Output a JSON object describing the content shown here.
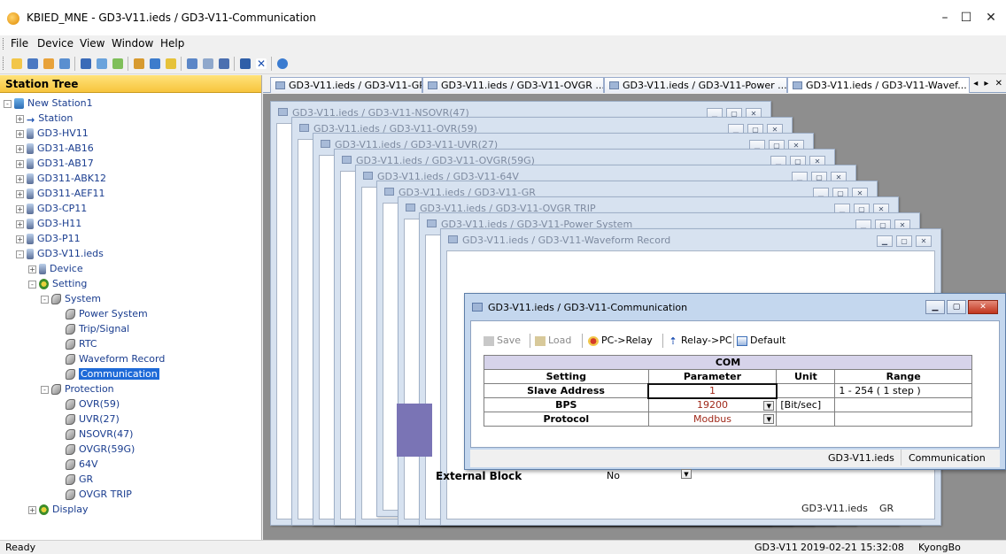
{
  "window": {
    "title": "KBIED_MNE - GD3-V11.ieds / GD3-V11-Communication",
    "controls": [
      "–",
      "☐",
      "✕"
    ]
  },
  "menu": [
    "File",
    "Device",
    "View",
    "Window",
    "Help"
  ],
  "toolbar_icons": [
    "new-icon",
    "save-icon",
    "open-icon",
    "network-icon",
    "list-icon",
    "device-icon",
    "refresh-icon",
    "edit-icon",
    "monitor-icon",
    "grid-icon",
    "window-icon",
    "tile-icon",
    "cascade-icon",
    "split-icon",
    "close-icon",
    "info-icon"
  ],
  "tree": {
    "header": "Station Tree",
    "items": [
      {
        "label": "New Station1",
        "expander": "-",
        "icon": "pc"
      },
      {
        "label": "Station",
        "expander": "+",
        "icon": "arrow"
      },
      {
        "label": "GD3-HV11",
        "expander": "+",
        "icon": "dev"
      },
      {
        "label": "GD31-AB16",
        "expander": "+",
        "icon": "dev"
      },
      {
        "label": "GD31-AB17",
        "expander": "+",
        "icon": "dev"
      },
      {
        "label": "GD311-ABK12",
        "expander": "+",
        "icon": "dev"
      },
      {
        "label": "GD311-AEF11",
        "expander": "+",
        "icon": "dev"
      },
      {
        "label": "GD3-CP11",
        "expander": "+",
        "icon": "dev"
      },
      {
        "label": "GD3-H11",
        "expander": "+",
        "icon": "dev"
      },
      {
        "label": "GD3-P11",
        "expander": "+",
        "icon": "dev"
      },
      {
        "label": "GD3-V11.ieds",
        "expander": "-",
        "icon": "dev"
      },
      {
        "label": "Device",
        "expander": "+",
        "icon": "dev"
      },
      {
        "label": "Setting",
        "expander": "-",
        "icon": "gear"
      },
      {
        "label": "System",
        "expander": "-",
        "icon": "wrench"
      },
      {
        "label": "Power System",
        "expander": "",
        "icon": "wrench"
      },
      {
        "label": "Trip/Signal",
        "expander": "",
        "icon": "wrench"
      },
      {
        "label": "RTC",
        "expander": "",
        "icon": "wrench"
      },
      {
        "label": "Waveform Record",
        "expander": "",
        "icon": "wrench"
      },
      {
        "label": "Communication",
        "expander": "",
        "icon": "wrench",
        "selected": true
      },
      {
        "label": "Protection",
        "expander": "-",
        "icon": "wrench"
      },
      {
        "label": "OVR(59)",
        "expander": "",
        "icon": "wrench"
      },
      {
        "label": "UVR(27)",
        "expander": "",
        "icon": "wrench"
      },
      {
        "label": "NSOVR(47)",
        "expander": "",
        "icon": "wrench"
      },
      {
        "label": "OVGR(59G)",
        "expander": "",
        "icon": "wrench"
      },
      {
        "label": "64V",
        "expander": "",
        "icon": "wrench"
      },
      {
        "label": "GR",
        "expander": "",
        "icon": "wrench"
      },
      {
        "label": "OVGR TRIP",
        "expander": "",
        "icon": "wrench"
      },
      {
        "label": "Display",
        "expander": "+",
        "icon": "gear"
      }
    ]
  },
  "tabs": [
    "GD3-V11.ieds / GD3-V11-GR",
    "GD3-V11.ieds / GD3-V11-OVGR ...",
    "GD3-V11.ieds / GD3-V11-Power ...",
    "GD3-V11.ieds / GD3-V11-Wavef..."
  ],
  "children": [
    "GD3-V11.ieds / GD3-V11-NSOVR(47)",
    "GD3-V11.ieds / GD3-V11-OVR(59)",
    "GD3-V11.ieds / GD3-V11-UVR(27)",
    "GD3-V11.ieds / GD3-V11-OVGR(59G)",
    "GD3-V11.ieds / GD3-V11-64V",
    "GD3-V11.ieds / GD3-V11-GR",
    "GD3-V11.ieds / GD3-V11-OVGR TRIP",
    "GD3-V11.ieds / GD3-V11-Power System",
    "GD3-V11.ieds / GD3-V11-Waveform Record"
  ],
  "gr_window": {
    "row_label": "External Block",
    "row_value": "No",
    "status_left": "GD3-V11.ieds",
    "status_right": "GR"
  },
  "comm": {
    "title": "GD3-V11.ieds / GD3-V11-Communication",
    "toolbar": {
      "save": "Save",
      "load": "Load",
      "pc_relay": "PC->Relay",
      "relay_pc": "Relay->PC",
      "default": "Default"
    },
    "caption": "COM",
    "headers": [
      "Setting",
      "Parameter",
      "Unit",
      "Range"
    ],
    "rows": [
      {
        "setting": "Slave Address",
        "parameter": "1",
        "unit": "",
        "range": "1 - 254 ( 1 step )"
      },
      {
        "setting": "BPS",
        "parameter": "19200",
        "unit": "[Bit/sec]",
        "range": ""
      },
      {
        "setting": "Protocol",
        "parameter": "Modbus",
        "unit": "",
        "range": ""
      }
    ],
    "status_left": "GD3-V11.ieds",
    "status_right": "Communication"
  },
  "status": {
    "left": "Ready",
    "device": "GD3-V11",
    "datetime": "2019-02-21 15:32:08",
    "user": "KyongBo"
  }
}
